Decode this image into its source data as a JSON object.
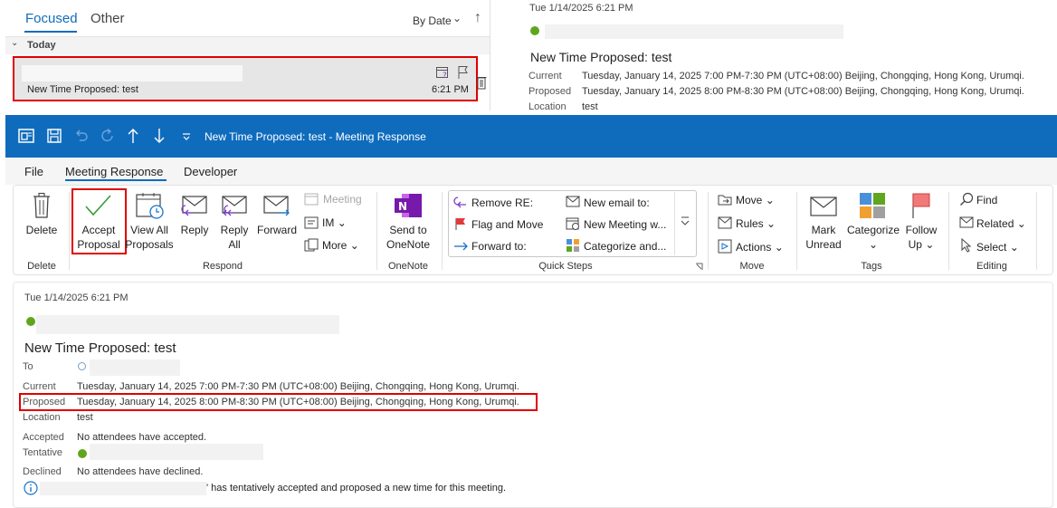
{
  "inbox": {
    "tabs": {
      "focused": "Focused",
      "other": "Other"
    },
    "sort_label": "By Date",
    "group_label": "Today",
    "item": {
      "subject": "New Time Proposed: test",
      "time": "6:21 PM"
    }
  },
  "preview": {
    "date": "Tue 1/14/2025 6:21 PM",
    "subject": "New Time Proposed: test",
    "rows": [
      {
        "label": "Current",
        "value": "Tuesday, January 14, 2025 7:00 PM-7:30 PM (UTC+08:00) Beijing, Chongqing, Hong Kong, Urumqi."
      },
      {
        "label": "Proposed",
        "value": "Tuesday, January 14, 2025 8:00 PM-8:30 PM (UTC+08:00) Beijing, Chongqing, Hong Kong, Urumqi."
      },
      {
        "label": "Location",
        "value": "test"
      }
    ]
  },
  "window": {
    "title": "New Time Proposed: test  -  Meeting Response",
    "accent": "#0f6cbd"
  },
  "menu": {
    "file": "File",
    "meeting_response": "Meeting Response",
    "developer": "Developer"
  },
  "ribbon": {
    "delete": {
      "label": "Delete",
      "group": "Delete"
    },
    "respond": {
      "group": "Respond",
      "accept_line1": "Accept",
      "accept_line2": "Proposal",
      "viewall_line1": "View All",
      "viewall_line2": "Proposals",
      "reply": "Reply",
      "replyall_line1": "Reply",
      "replyall_line2": "All",
      "forward": "Forward",
      "meeting": "Meeting",
      "im": "IM",
      "more": "More"
    },
    "onenote": {
      "line1": "Send to",
      "line2": "OneNote",
      "group": "OneNote"
    },
    "quick_steps": {
      "group": "Quick Steps",
      "items": [
        "Remove RE:",
        "Flag and Move",
        "Forward to:",
        "New email to:",
        "New Meeting w...",
        "Categorize and..."
      ]
    },
    "move": {
      "move": "Move",
      "rules": "Rules",
      "actions": "Actions",
      "group": "Move"
    },
    "tags": {
      "mark_line1": "Mark",
      "mark_line2": "Unread",
      "categorize": "Categorize",
      "follow_line1": "Follow",
      "follow_line2": "Up",
      "group": "Tags"
    },
    "editing": {
      "find": "Find",
      "related": "Related",
      "select": "Select",
      "group": "Editing"
    }
  },
  "meeting": {
    "date": "Tue 1/14/2025 6:21 PM",
    "subject": "New Time Proposed: test",
    "to_label": "To",
    "current_label": "Current",
    "current_value": "Tuesday, January 14, 2025 7:00 PM-7:30 PM (UTC+08:00) Beijing, Chongqing, Hong Kong, Urumqi.",
    "proposed_label": "Proposed",
    "proposed_value": "Tuesday, January 14, 2025 8:00 PM-8:30 PM (UTC+08:00) Beijing, Chongqing, Hong Kong, Urumqi.",
    "location_label": "Location",
    "location_value": "test",
    "accepted_label": "Accepted",
    "accepted_value": "No attendees have accepted.",
    "tentative_label": "Tentative",
    "declined_label": "Declined",
    "declined_value": "No attendees have declined.",
    "info_text": "' has tentatively accepted and proposed a new time for this meeting."
  }
}
